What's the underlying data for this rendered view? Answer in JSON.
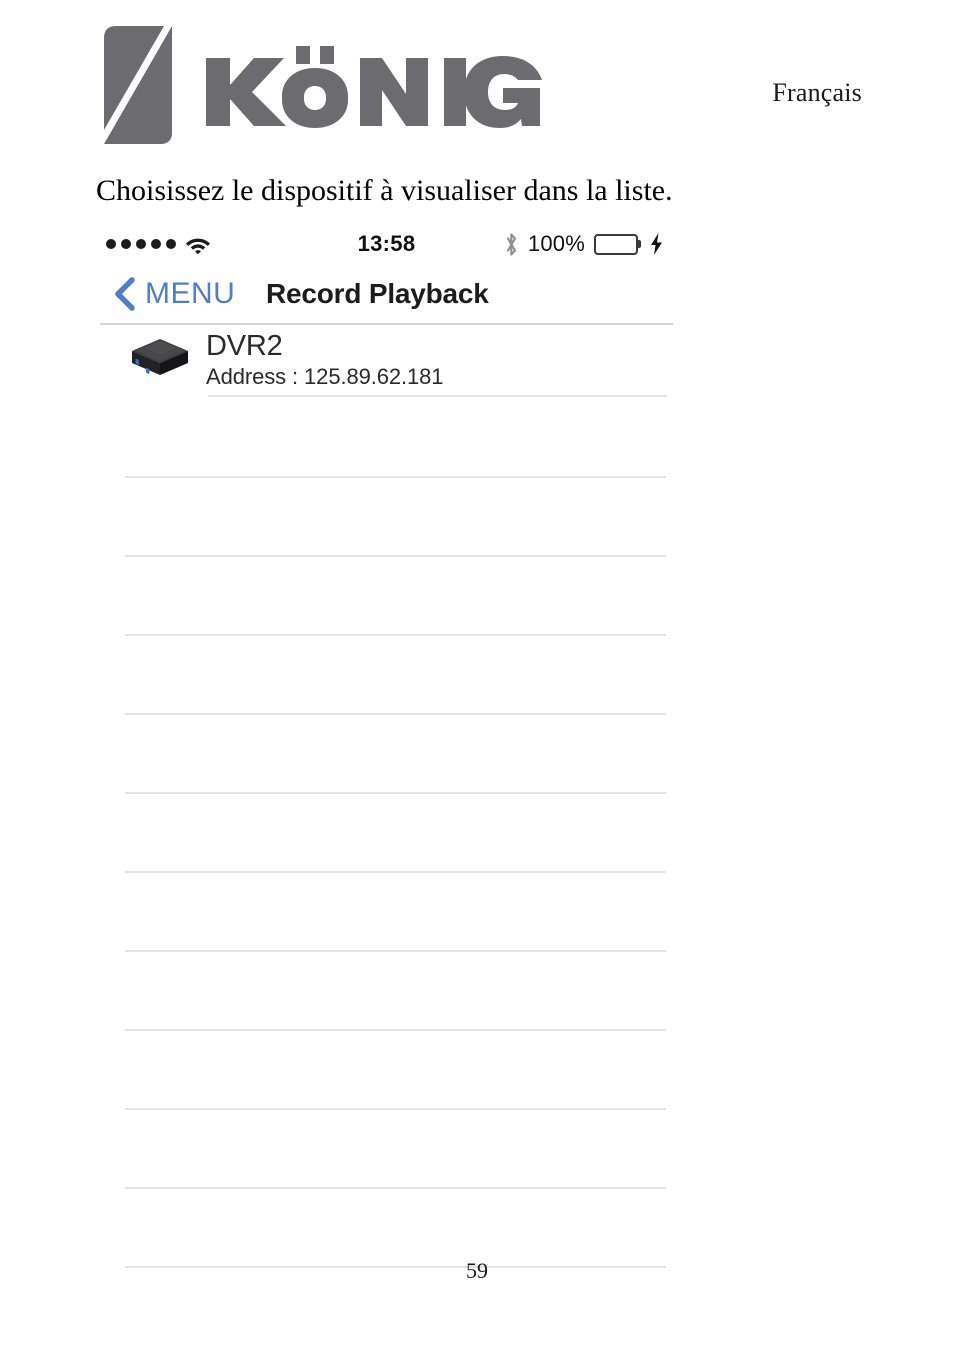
{
  "document": {
    "language_label": "Français",
    "brand_name": "KÖNIG",
    "instruction": "Choisissez le dispositif à visualiser dans la liste.",
    "page_number": "59",
    "brand_color": "#6b6b70"
  },
  "phone": {
    "status_bar": {
      "signal_dots": 5,
      "wifi_icon": "wifi-icon",
      "time": "13:58",
      "bluetooth_icon": "bluetooth-icon",
      "battery_percent": "100%",
      "battery_level": 100,
      "battery_color": "#5cd152",
      "charging_icon": "lightning-bolt-icon"
    },
    "nav_bar": {
      "back_icon": "chevron-left-icon",
      "back_label": "MENU",
      "title": "Record Playback",
      "accent_color": "#4f7dc9"
    },
    "device_list": {
      "items": [
        {
          "icon": "dvr-device-icon",
          "name": "DVR2",
          "address": "Address : 125.89.62.181"
        }
      ],
      "empty_row_count": 11,
      "separator_color": "#e2e2e4"
    }
  }
}
